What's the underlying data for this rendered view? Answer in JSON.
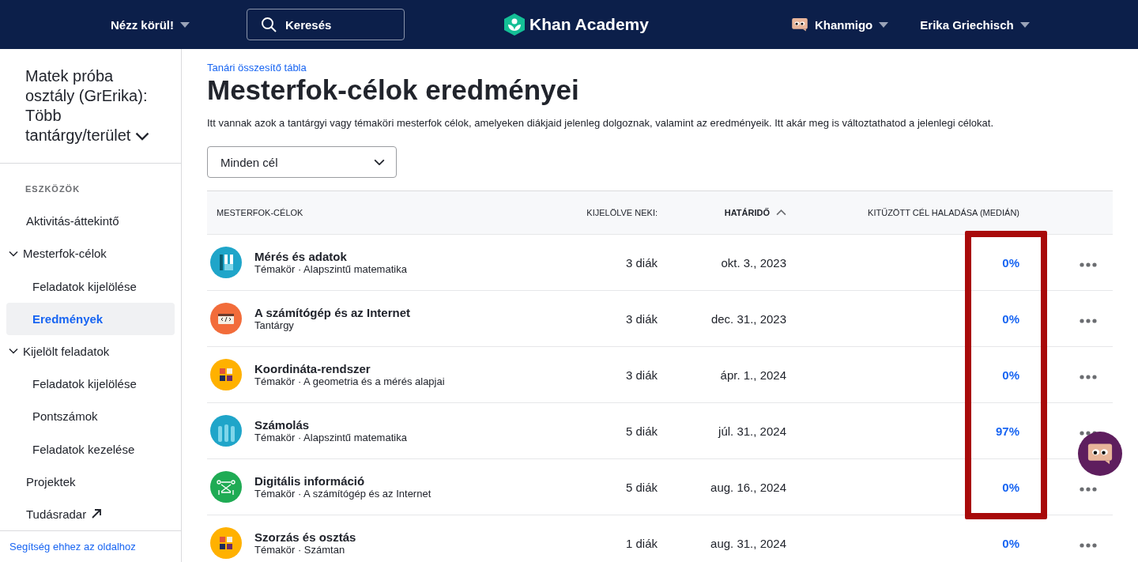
{
  "header": {
    "explore": "Nézz körül!",
    "search": {
      "placeholder": "Keresés"
    },
    "logo": "Khan Academy",
    "khanmigo": "Khanmigo",
    "user": "Erika Griechisch"
  },
  "sidebar": {
    "class_name": "Matek próba osztály (GrErika): Több tantárgy/terület",
    "section_label": "ESZKÖZÖK",
    "items": [
      {
        "label": "Aktivitás-áttekintő",
        "kind": "link",
        "selected": false
      },
      {
        "label": "Mesterfok-célok",
        "kind": "group",
        "expanded": true,
        "children": [
          {
            "label": "Feladatok kijelölése",
            "kind": "link",
            "selected": false
          },
          {
            "label": "Eredmények",
            "kind": "link",
            "selected": true
          }
        ]
      },
      {
        "label": "Kijelölt feladatok",
        "kind": "group",
        "expanded": true,
        "children": [
          {
            "label": "Feladatok kijelölése",
            "kind": "link",
            "selected": false
          },
          {
            "label": "Pontszámok",
            "kind": "link",
            "selected": false
          },
          {
            "label": "Feladatok kezelése",
            "kind": "link",
            "selected": false
          }
        ]
      },
      {
        "label": "Projektek",
        "kind": "link",
        "selected": false
      },
      {
        "label": "Tudásradar",
        "kind": "external",
        "selected": false
      }
    ],
    "help": "Segítség ehhez az oldalhoz"
  },
  "breadcrumb": "Tanári összesítő tábla",
  "title": "Mesterfok-célok eredményei",
  "description": "Itt vannak azok a tantárgyi vagy témaköri mesterfok célok, amelyeken diákjaid jelenleg dolgoznak, valamint az eredményeik. Itt akár meg is változtathatod a jelenlegi célokat.",
  "filter": {
    "value": "Minden cél"
  },
  "table": {
    "columns": [
      {
        "label": "MESTERFOK-CÉLOK",
        "sorted": false
      },
      {
        "label": "KIJELÖLVE NEKI:",
        "sorted": false
      },
      {
        "label": "HATÁRIDŐ",
        "sorted": true
      },
      {
        "label": "KITŰZÖTT CÉL HALADÁSA (MEDIÁN)",
        "sorted": false
      }
    ],
    "rows": [
      {
        "kind": "bars",
        "title": "Mérés és adatok",
        "subtitle": "Témakör · Alapszintű matematika",
        "assigned": "3 diák",
        "due": "okt. 3., 2023",
        "progress": "0%"
      },
      {
        "kind": "code",
        "title": "A számítógép és az Internet",
        "subtitle": "Tantárgy",
        "assigned": "3 diák",
        "due": "dec. 31., 2023",
        "progress": "0%"
      },
      {
        "kind": "calc",
        "title": "Koordináta-rendszer",
        "subtitle": "Témakör · A geometria és a mérés alapjai",
        "assigned": "3 diák",
        "due": "ápr. 1., 2024",
        "progress": "0%"
      },
      {
        "kind": "hands",
        "title": "Számolás",
        "subtitle": "Témakör · Alapszintű matematika",
        "assigned": "5 diák",
        "due": "júl. 31., 2024",
        "progress": "97%"
      },
      {
        "kind": "binary",
        "title": "Digitális információ",
        "subtitle": "Témakör · A számítógép és az Internet",
        "assigned": "5 diák",
        "due": "aug. 16., 2024",
        "progress": "0%"
      },
      {
        "kind": "calc",
        "title": "Szorzás és osztás",
        "subtitle": "Témakör · Számtan",
        "assigned": "1 diák",
        "due": "aug. 31., 2024",
        "progress": "0%"
      }
    ],
    "highlight_progress": true
  }
}
